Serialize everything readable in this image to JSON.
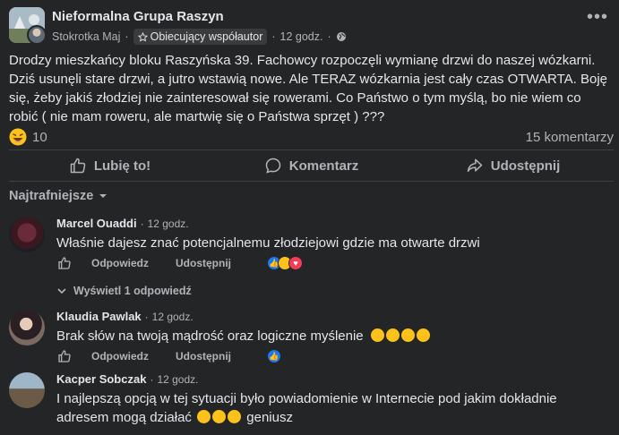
{
  "post": {
    "group_name": "Nieformalna Grupa Raszyn",
    "author": "Stokrotka Maj",
    "badge": "Obiecujący współautor",
    "separator": "·",
    "time": "12 godz.",
    "body": "Drodzy mieszkańcy bloku Raszyńska 39. Fachowcy rozpoczęli wymianę drzwi do naszej wózkarni. Dziś usunęli stare drzwi, a jutro wstawią nowe. Ale TERAZ wózkarnia jest cały czas OTWARTA. Boję się, żeby jakiś złodziej nie zainteresował się rowerami. Co Państwo o tym myślą, bo nie wiem co robić ( nie mam roweru, ale martwię się o Państwa sprzęt ) ???",
    "reaction_count": "10",
    "comment_count": "15 komentarzy"
  },
  "actions": {
    "like": "Lubię to!",
    "comment": "Komentarz",
    "share": "Udostępnij"
  },
  "sort_label": "Najtrafniejsze",
  "comments": [
    {
      "name": "Marcel Ouaddi",
      "time": "12 godz.",
      "text": "Właśnie dajesz znać potencjalnemu złodziejowi gdzie ma otwarte drzwi",
      "reply": "Odpowiedz",
      "share": "Udostępnij",
      "replies_link": "Wyświetl 1 odpowiedź"
    },
    {
      "name": "Klaudia Pawlak",
      "time": "12 godz.",
      "text": "Brak słów na twoją mądrość oraz logiczne myślenie",
      "reply": "Odpowiedz",
      "share": "Udostępnij"
    },
    {
      "name": "Kacper Sobczak",
      "time": "12 godz.",
      "text_line1": "I najlepszą opcją w tej sytuacji było powiadomienie w Internecie pod jakim dokładnie",
      "text_line2_a": "adresem mogą działać",
      "text_line2_b": "geniusz"
    }
  ],
  "colors": {
    "background": "#242526",
    "text": "#e4e6eb",
    "muted": "#b0b3b8",
    "like_blue": "#1877f2",
    "love_red": "#f33e58"
  }
}
